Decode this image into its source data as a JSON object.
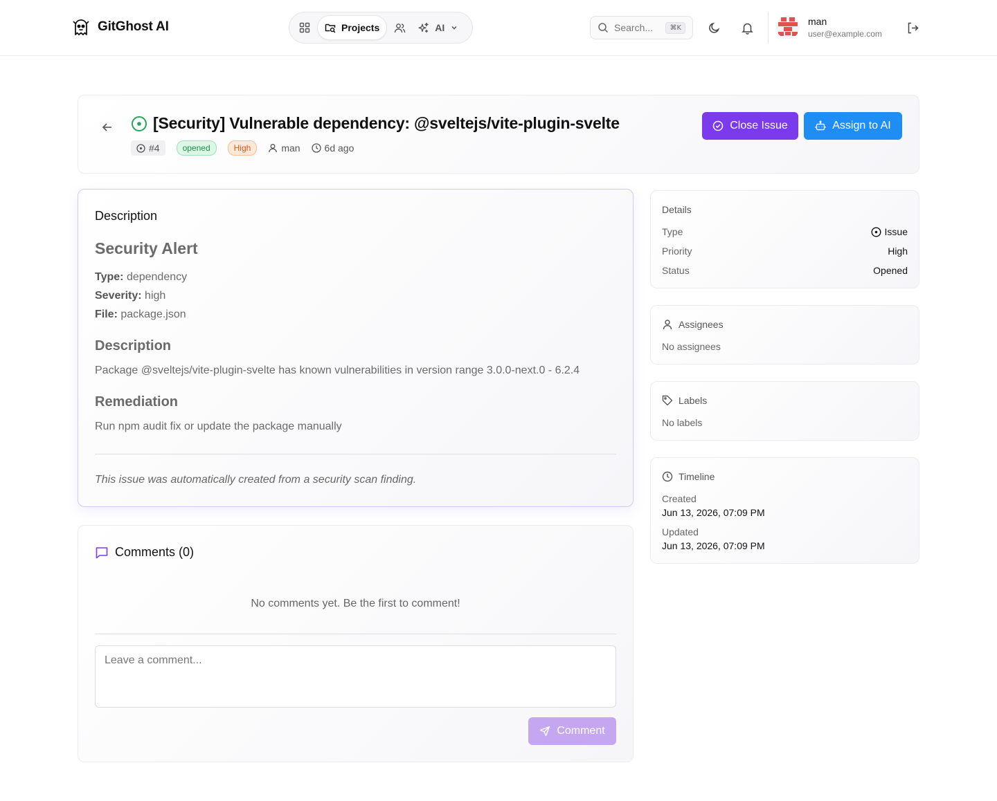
{
  "app": {
    "name": "GitGhost AI"
  },
  "nav": {
    "active_label": "Projects",
    "ai_label": "AI"
  },
  "search": {
    "placeholder": "Search...",
    "shortcut": "⌘K"
  },
  "user": {
    "name": "man",
    "email": "user@example.com"
  },
  "issue": {
    "title": "[Security] Vulnerable dependency: @sveltejs/vite-plugin-svelte",
    "number": "#4",
    "state_badge": "opened",
    "priority_badge": "High",
    "author": "man",
    "age": "6d ago",
    "close_button": "Close Issue",
    "assign_button": "Assign to AI"
  },
  "description": {
    "section_title": "Description",
    "heading": "Security Alert",
    "fields": [
      {
        "label": "Type:",
        "value": "dependency"
      },
      {
        "label": "Severity:",
        "value": "high"
      },
      {
        "label": "File:",
        "value": "package.json"
      }
    ],
    "desc_heading": "Description",
    "desc_text": "Package @sveltejs/vite-plugin-svelte has known vulnerabilities in version range 3.0.0-next.0 - 6.2.4",
    "remediation_heading": "Remediation",
    "remediation_text": "Run npm audit fix or update the package manually",
    "footer_note": "This issue was automatically created from a security scan finding."
  },
  "comments": {
    "title": "Comments (0)",
    "empty": "No comments yet. Be the first to comment!",
    "placeholder": "Leave a comment...",
    "submit": "Comment"
  },
  "details": {
    "title": "Details",
    "rows": [
      {
        "key": "Type",
        "value": "Issue"
      },
      {
        "key": "Priority",
        "value": "High"
      },
      {
        "key": "Status",
        "value": "Opened"
      }
    ]
  },
  "assignees": {
    "title": "Assignees",
    "empty": "No assignees"
  },
  "labels": {
    "title": "Labels",
    "empty": "No labels"
  },
  "timeline": {
    "title": "Timeline",
    "created_label": "Created",
    "created_value": "Jun 13, 2026, 07:09 PM",
    "updated_label": "Updated",
    "updated_value": "Jun 13, 2026, 07:09 PM"
  },
  "colors": {
    "accent_purple": "#7c3aed",
    "accent_blue": "#1e8ef5",
    "status_green": "#22a55a"
  }
}
